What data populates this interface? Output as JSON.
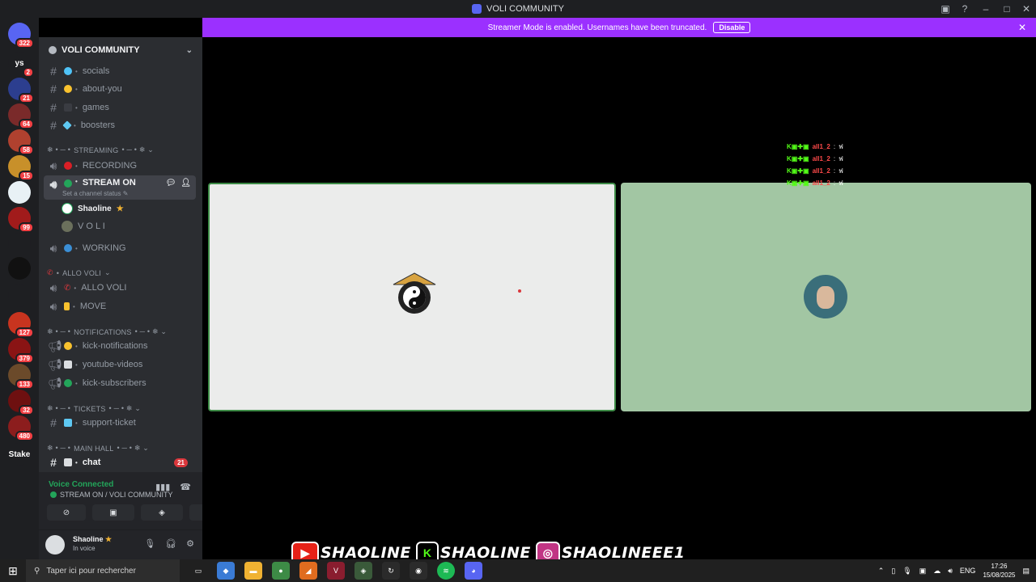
{
  "window": {
    "title": "VOLI COMMUNITY"
  },
  "banner": {
    "message": "Streamer Mode is enabled. Usernames have been truncated.",
    "disable_label": "Disable"
  },
  "guilds": [
    {
      "label": "",
      "badge": "322",
      "color": "#5865f2"
    },
    {
      "label": "ys",
      "badge": "2",
      "color": "#1e1f22"
    },
    {
      "label": "",
      "badge": "21",
      "color": "#2c3e8f"
    },
    {
      "label": "",
      "badge": "64",
      "color": "#7a2a2a"
    },
    {
      "label": "",
      "badge": "58",
      "color": "#b0412f"
    },
    {
      "label": "",
      "badge": "15",
      "color": "#c8902a"
    },
    {
      "label": "",
      "badge": "",
      "color": "#e8f1f5"
    },
    {
      "label": "",
      "badge": "99",
      "color": "#a11b1b"
    },
    {
      "label": "",
      "badge": "",
      "color": "#1e1f22"
    },
    {
      "label": "",
      "badge": "",
      "color": "#111111"
    },
    {
      "label": "",
      "badge": "",
      "color": "#1e1f22"
    },
    {
      "label": "",
      "badge": "127",
      "color": "#c8341f"
    },
    {
      "label": "",
      "badge": "379",
      "color": "#8a1414"
    },
    {
      "label": "",
      "badge": "133",
      "color": "#6b4a2a"
    },
    {
      "label": "",
      "badge": "32",
      "color": "#6e1010"
    },
    {
      "label": "",
      "badge": "480",
      "color": "#8c1d1d"
    },
    {
      "label": "Stake",
      "badge": "",
      "color": "#1e1f22"
    }
  ],
  "server": {
    "name": "VOLI COMMUNITY"
  },
  "channels": {
    "socials": "socials",
    "about_you": "about-you",
    "games": "games",
    "boosters": "boosters",
    "streaming_cat": "STREAMING",
    "recording": "RECORDING",
    "stream_on": "STREAM ON",
    "set_status": "Set a channel status",
    "member1": "Shaoline",
    "member2": "V O L I",
    "working": "WORKING",
    "allo_cat": "ALLO VOLI",
    "allo": "ALLO VOLI",
    "move": "MOVE",
    "notif_cat": "NOTIFICATIONS",
    "kick_notif": "kick-notifications",
    "yt": "youtube-videos",
    "kick_subs": "kick-subscribers",
    "tickets_cat": "TICKETS",
    "support": "support-ticket",
    "hall_cat": "MAIN HALL",
    "chat": "chat",
    "chat_badge": "21"
  },
  "voice": {
    "status": "Voice Connected",
    "location": "STREAM ON / VOLI COMMUNITY"
  },
  "user": {
    "name": "Shaoline",
    "status": "In voice"
  },
  "overlay": {
    "kick_rows": [
      {
        "user": "all1_2",
        "msg": "ฟ"
      },
      {
        "user": "all1_2",
        "msg": "ฟ"
      },
      {
        "user": "all1_2",
        "msg": "ฟ"
      },
      {
        "user": "all1_2",
        "msg": "ฟ"
      }
    ],
    "socials": [
      {
        "platform": "youtube",
        "handle": "SHAOLINE",
        "color": "#e62117"
      },
      {
        "platform": "kick",
        "handle": "SHAOLINE",
        "color": "#53fc18"
      },
      {
        "platform": "instagram",
        "handle": "SHAOLINEEE1",
        "color": "#c13584"
      }
    ]
  },
  "taskbar": {
    "search_placeholder": "Taper ici pour rechercher",
    "lang": "ENG",
    "time": "17:26",
    "date": "15/08/2025"
  }
}
